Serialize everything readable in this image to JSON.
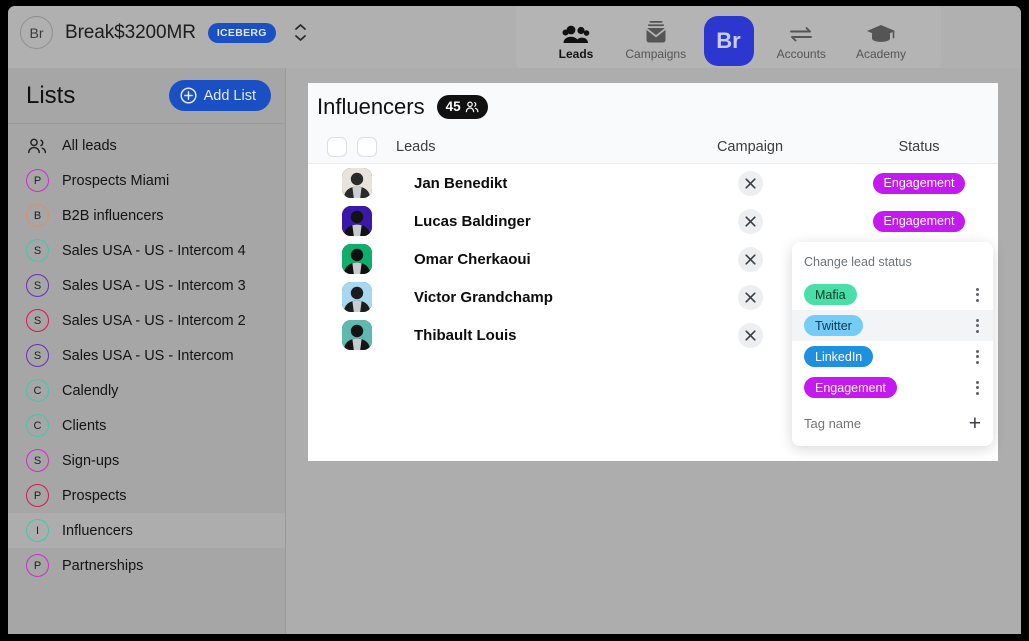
{
  "colors": {
    "brand_blue": "#1b4fc4",
    "logo_blue": "#2b37cf",
    "window_bg": "#aaaaaa",
    "sidebar_bg": "#a6a6a6",
    "main_bg": "#adadad",
    "card_bg": "#ffffff",
    "engagement": "#c41af0",
    "mafia": "#4adfa8",
    "twitter": "#74cdf7",
    "linkedin": "#1f8fe0"
  },
  "topbar": {
    "avatar_initials": "Br",
    "account_name": "Break$3200MR",
    "plan_badge": "ICEBERG",
    "stepper_name": "account-stepper",
    "nav": [
      {
        "label": "Leads",
        "icon": "people-icon",
        "active": true
      },
      {
        "label": "Campaigns",
        "icon": "envelope-icon",
        "active": false
      },
      {
        "label": "Accounts",
        "icon": "swap-arrows-icon",
        "active": false
      },
      {
        "label": "Academy",
        "icon": "graduation-cap-icon",
        "active": false
      }
    ],
    "logo_label": "Br"
  },
  "sidebar": {
    "title": "Lists",
    "add_button": "Add List",
    "add_icon": "plus-circle-icon",
    "items": [
      {
        "label": "All leads",
        "initial": "",
        "ring": "",
        "icon": "people-outline-icon",
        "selected": false
      },
      {
        "label": "Prospects Miami",
        "initial": "P",
        "ring": "#cc2fc8",
        "selected": false
      },
      {
        "label": "B2B influencers",
        "initial": "B",
        "ring": "#d6926a",
        "selected": false
      },
      {
        "label": "Sales USA - US - Intercom 4",
        "initial": "S",
        "ring": "#3fc9ab",
        "selected": false
      },
      {
        "label": "Sales USA - US - Intercom 3",
        "initial": "S",
        "ring": "#6b2bc4",
        "selected": false
      },
      {
        "label": "Sales USA - US - Intercom 2",
        "initial": "S",
        "ring": "#d6174f",
        "selected": false
      },
      {
        "label": "Sales USA - US - Intercom",
        "initial": "S",
        "ring": "#6b2bc4",
        "selected": false
      },
      {
        "label": "Calendly",
        "initial": "C",
        "ring": "#3fc9ab",
        "selected": false
      },
      {
        "label": "Clients",
        "initial": "C",
        "ring": "#3fc9ab",
        "selected": false
      },
      {
        "label": "Sign-ups",
        "initial": "S",
        "ring": "#cc2fc8",
        "selected": false
      },
      {
        "label": "Prospects",
        "initial": "P",
        "ring": "#d6174f",
        "selected": false
      },
      {
        "label": "Influencers",
        "initial": "I",
        "ring": "#3fc9ab",
        "selected": true
      },
      {
        "label": "Partnerships",
        "initial": "P",
        "ring": "#cc2fc8",
        "selected": false
      }
    ]
  },
  "main": {
    "page_title": "Influencers",
    "count": "45",
    "count_icon": "people-icon",
    "columns": {
      "leads": "Leads",
      "campaign": "Campaign",
      "status": "Status"
    },
    "rows": [
      {
        "name": "Jan Benedikt",
        "campaign_action": "remove",
        "status": "Engagement",
        "status_color": "#c41af0",
        "av1": "#e8e3dd",
        "av2": "#2a2a2a"
      },
      {
        "name": "Lucas Baldinger",
        "campaign_action": "remove",
        "status": "Engagement",
        "status_color": "#c41af0",
        "av1": "#3a18a8",
        "av2": "#121212"
      },
      {
        "name": "Omar Cherkaoui",
        "campaign_action": "remove",
        "status": "",
        "status_color": "",
        "av1": "#0fae6a",
        "av2": "#101010"
      },
      {
        "name": "Victor Grandchamp",
        "campaign_action": "remove",
        "status": "",
        "status_color": "",
        "av1": "#a8d8f0",
        "av2": "#1c1c1c"
      },
      {
        "name": "Thibault Louis",
        "campaign_action": "remove",
        "status": "",
        "status_color": "",
        "av1": "#5fb9b0",
        "av2": "#141414"
      }
    ]
  },
  "dropdown": {
    "title": "Change lead status",
    "tags": [
      {
        "label": "Mafia",
        "color": "#4adfa8",
        "text": "#0d3b29",
        "hover": false
      },
      {
        "label": "Twitter",
        "color": "#74cdf7",
        "text": "#0e3750",
        "hover": true
      },
      {
        "label": "LinkedIn",
        "color": "#1f8fe0",
        "text": "#ffffff",
        "hover": false
      },
      {
        "label": "Engagement",
        "color": "#c41af0",
        "text": "#ffffff",
        "hover": false
      }
    ],
    "input_placeholder": "Tag name",
    "add_icon": "plus-icon"
  }
}
